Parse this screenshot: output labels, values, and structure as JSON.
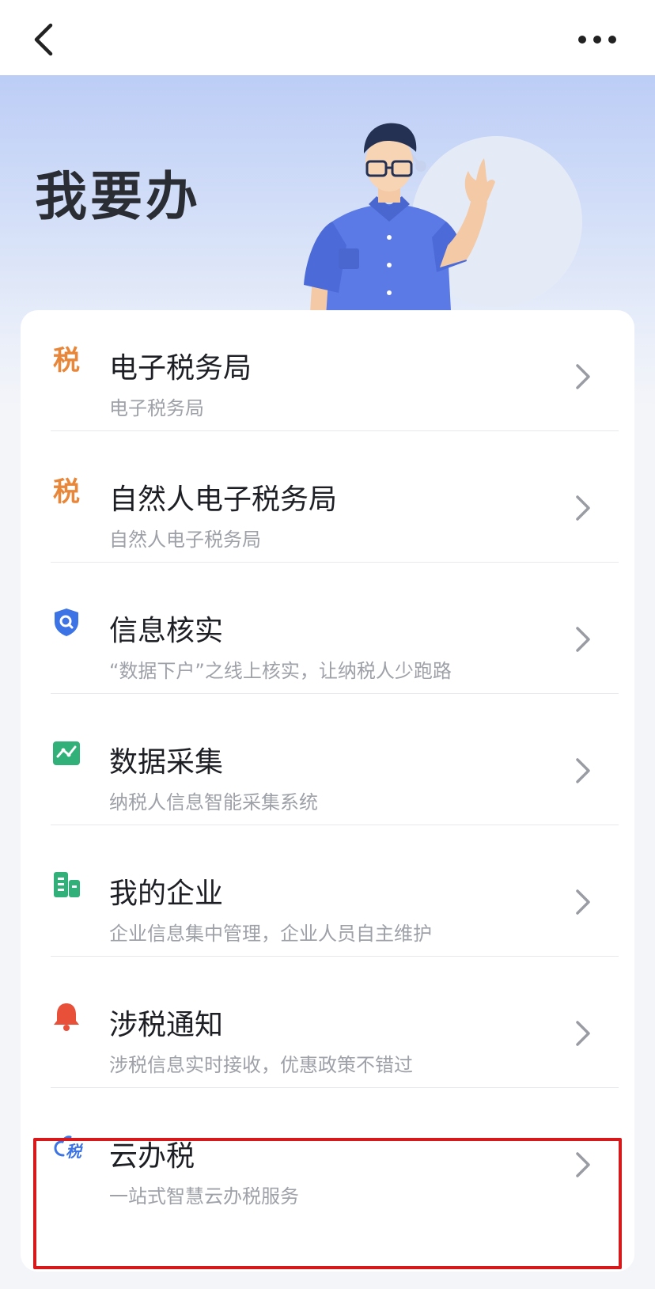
{
  "nav": {
    "back_icon": "chevron-left-icon",
    "more_icon": "ellipsis-icon"
  },
  "hero": {
    "title": "我要办"
  },
  "items": [
    {
      "title": "电子税务局",
      "subtitle": "电子税务局",
      "icon": "tax-orange-icon",
      "icon_text": "税",
      "color": "#e8863a"
    },
    {
      "title": "自然人电子税务局",
      "subtitle": "自然人电子税务局",
      "icon": "tax-orange-icon",
      "icon_text": "税",
      "color": "#e8863a"
    },
    {
      "title": "信息核实",
      "subtitle": "“数据下户”之线上核实，让纳税人少跑路",
      "icon": "shield-search-icon",
      "color": "#3c74e6"
    },
    {
      "title": "数据采集",
      "subtitle": "纳税人信息智能采集系统",
      "icon": "data-collect-icon",
      "color": "#31b07a"
    },
    {
      "title": "我的企业",
      "subtitle": "企业信息集中管理，企业人员自主维护",
      "icon": "enterprise-icon",
      "color": "#31b07a"
    },
    {
      "title": "涉税通知",
      "subtitle": "涉税信息实时接收，优惠政策不错过",
      "icon": "bell-icon",
      "color": "#e8503a"
    },
    {
      "title": "云办税",
      "subtitle": "一站式智慧云办税服务",
      "icon": "cloud-tax-icon",
      "icon_text": "税",
      "color": "#3c74e6"
    }
  ],
  "highlight_color": "#d7191c"
}
